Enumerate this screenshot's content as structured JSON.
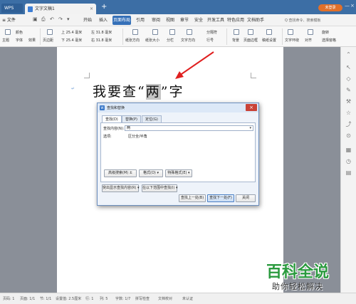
{
  "titlebar": {
    "app_tab": "WPS",
    "doc_tab": "文字文稿1",
    "doc_tab_close": "×",
    "new_tab": "+",
    "sign_badge": "未登录",
    "win_min": "—",
    "win_max": "□",
    "win_close": "×"
  },
  "menubar": {
    "file": "≡ 文件",
    "items": [
      "开始",
      "插入",
      "页面布局",
      "引用",
      "审阅",
      "视图",
      "章节",
      "安全",
      "开发工具",
      "特色应用",
      "文档助手"
    ],
    "active_index": 2,
    "search": "Q 查找命令、搜索模板"
  },
  "ribbon": {
    "items": [
      "主题",
      "颜色",
      "字体",
      "效果",
      "页边距",
      "纸张方向",
      "纸张大小",
      "分栏",
      "文字方向",
      "行号",
      "背景",
      "页面边框",
      "稿纸设置",
      "文字环绕",
      "对齐",
      "旋转",
      "选择窗格"
    ],
    "values": [
      "上 25.4 毫米",
      "下 25.4 毫米",
      "左 31.8 毫米",
      "右 31.8 毫米",
      "分隔符",
      "行号"
    ]
  },
  "document": {
    "para_mark": "↵",
    "text_before": "我要查“",
    "text_highlight": "两",
    "text_after": "”字"
  },
  "dialog": {
    "icon": "W",
    "title": "查找和替换",
    "close": "×",
    "tabs": [
      "查找(D)",
      "替换(P)",
      "定位(G)"
    ],
    "active_tab": 0,
    "find_label": "查找内容(N):",
    "find_value": "两",
    "options_label": "选项:",
    "options_value": "区分全/半角",
    "btn_advanced": "高级搜索(M) ±",
    "btn_format": "格式(O) ▾",
    "btn_special": "特殊格式(E) ▾",
    "btn_highlight": "突出显示查找内容(R) ▾",
    "btn_find_in": "在以下范围中查找(I) ▾",
    "btn_prev": "查找上一处(B)",
    "btn_next": "查找下一处(F)",
    "btn_close": "关闭"
  },
  "statusbar": {
    "items": [
      "页码: 1",
      "页面: 1/1",
      "节: 1/1",
      "设置值: 2.5厘米",
      "行: 1",
      "列: 5",
      "字数: 1/7",
      "拼写检查",
      "文档校对",
      "未认证"
    ]
  },
  "watermark": {
    "main": "百科全说",
    "sub": "助你轻松解决"
  },
  "colors": {
    "titlebar": "#3c6ea5",
    "active_menu": "#3570b8",
    "highlight": "#c5c5c5",
    "arrow": "#e02020",
    "watermark": "#2a9a3e"
  }
}
